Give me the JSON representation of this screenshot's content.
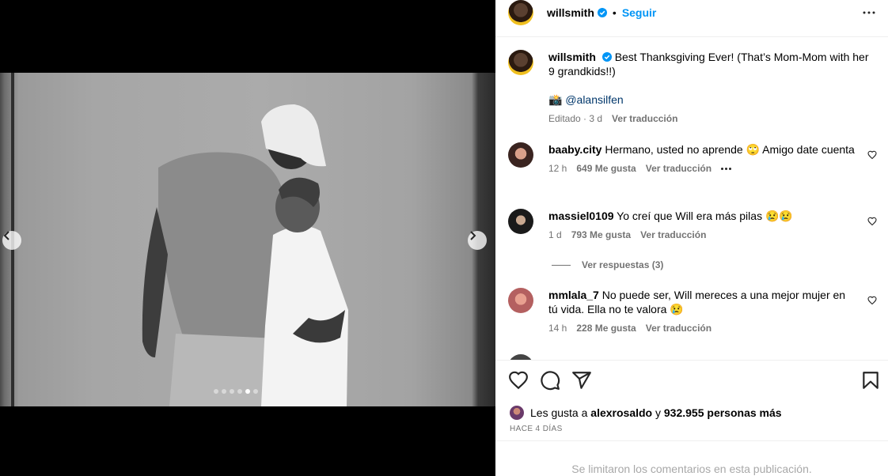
{
  "post": {
    "author": "willsmith",
    "follow_label": "Seguir",
    "bullet": "•",
    "caption_author": "willsmith",
    "caption_text": "Best Thanksgiving Ever! (That’s Mom-Mom with her 9 grandkids!!)",
    "credit_emoji": "📸",
    "credit_mention": "@alansilfen",
    "caption_edited": "Editado · 3 d",
    "caption_translate": "Ver traducción",
    "carousel": {
      "count": 6,
      "active_index": 4
    }
  },
  "comments": [
    {
      "user": "baaby.city",
      "text": "Hermano, usted no aprende 🙄 Amigo date cuenta",
      "time": "12 h",
      "likes": "649 Me gusta",
      "translate": "Ver traducción"
    },
    {
      "user": "massiel0109",
      "text": "Yo creí que Will era más pilas 😢😢",
      "time": "1 d",
      "likes": "793 Me gusta",
      "translate": "Ver traducción",
      "replies": "Ver respuestas (3)"
    },
    {
      "user": "mmlala_7",
      "text": "No puede ser, Will mereces a una mejor mujer en tú vida. Ella no te valora 😢",
      "time": "14 h",
      "likes": "228 Me gusta",
      "translate": "Ver traducción"
    }
  ],
  "likes": {
    "prefix": "Les gusta a",
    "user": "alexrosaldo",
    "conj": "y",
    "others": "932.955 personas más"
  },
  "date": "HACE 4 DÍAS",
  "comments_limited": "Se limitaron los comentarios en esta publicación.",
  "icons": {
    "verified": "verified-badge-icon",
    "more": "more-horizontal-icon",
    "heart": "heart-icon",
    "comment": "comment-icon",
    "share": "share-icon",
    "save": "bookmark-icon"
  },
  "colors": {
    "accent": "#0095f6",
    "verified": "#0095f6",
    "meta": "#737373"
  }
}
